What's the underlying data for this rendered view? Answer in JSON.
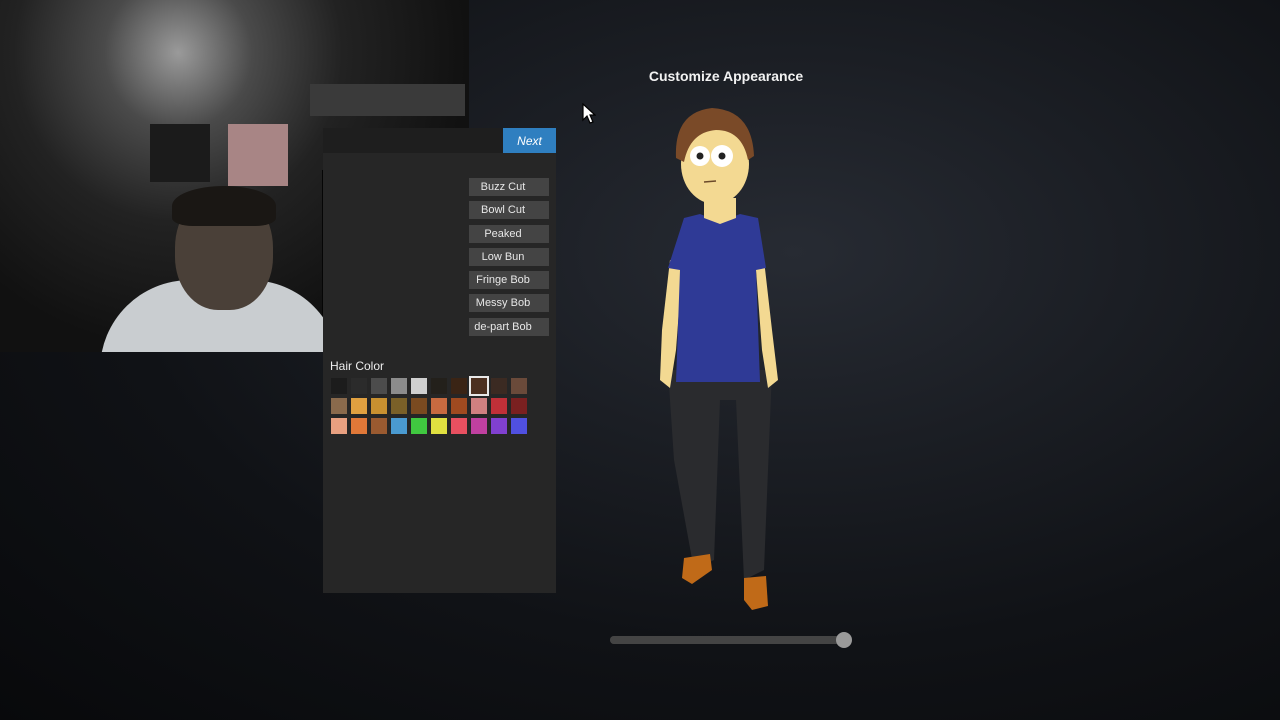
{
  "screen": {
    "title": "Customize Appearance"
  },
  "panel": {
    "next_label": "Next",
    "hair_styles": [
      "Buzz Cut",
      "Bowl Cut",
      "Peaked",
      "Low Bun",
      "Fringe Bob",
      "Messy Bob",
      "de-part Bob"
    ],
    "hair_color_label": "Hair Color",
    "hair_colors": [
      "#1c1c1c",
      "#2b2b2b",
      "#4c4c4c",
      "#8c8c8c",
      "#cfcfcf",
      "#23201b",
      "#3a2415",
      "#4c3020",
      "#3b2a22",
      "#6a4a3a",
      "#8a6a4c",
      "#e0a040",
      "#c89030",
      "#7a6028",
      "#7a4a20",
      "#c86a40",
      "#a04a20",
      "#d08080",
      "#c03038",
      "#7a2020",
      "#e8a080",
      "#e07838",
      "#9a5a30",
      "#4a9ad0",
      "#40c840",
      "#e0e040",
      "#e85060",
      "#c040a0",
      "#8040d0",
      "#5050e0"
    ],
    "selected_hair_color_index": 7
  },
  "zoom_slider": {
    "value": 0.99
  },
  "character": {
    "hair_color": "#7a4a28",
    "skin_color": "#f3d992",
    "shirt_color": "#2f3a96",
    "pants_color": "#2a2b2e",
    "shoe_color": "#c06a18"
  }
}
